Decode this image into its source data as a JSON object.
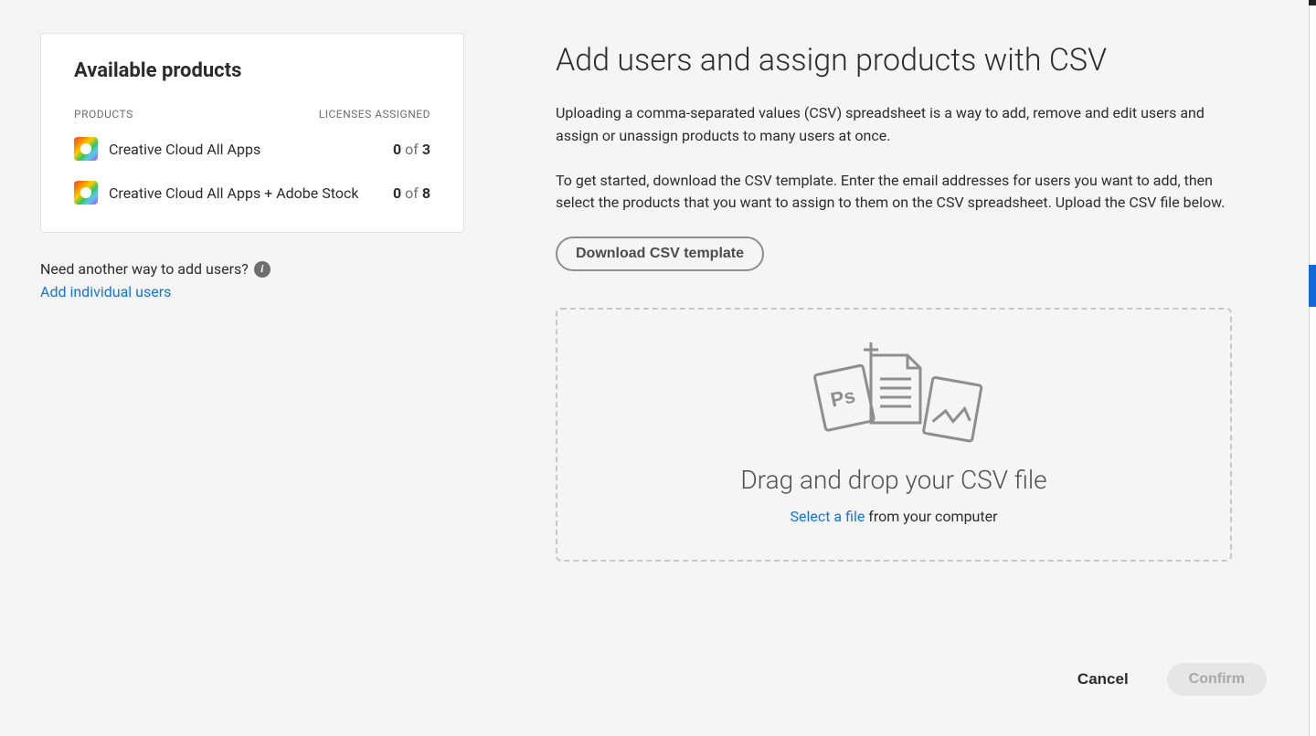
{
  "left": {
    "panel_title": "Available products",
    "col_products": "PRODUCTS",
    "col_licenses": "LICENSES ASSIGNED",
    "products": [
      {
        "name": "Creative Cloud All Apps",
        "used": "0",
        "of": "of",
        "total": "3"
      },
      {
        "name": "Creative Cloud All Apps + Adobe Stock",
        "used": "0",
        "of": "of",
        "total": "8"
      }
    ],
    "need_another": "Need another way to add users?",
    "add_individual": "Add individual users"
  },
  "main": {
    "title": "Add users and assign products with CSV",
    "para1": "Uploading a comma-separated values (CSV) spreadsheet is a way to add, remove and edit users and assign or unassign products to many users at once.",
    "para2": "To get started, download the CSV template. Enter the email addresses for users you want to add, then select the products that you want to assign to them on the CSV spreadsheet. Upload the CSV file below.",
    "download_btn": "Download CSV template",
    "drop_title": "Drag and drop your CSV file",
    "select_file": "Select a file",
    "from_computer": " from your computer"
  },
  "footer": {
    "cancel": "Cancel",
    "confirm": "Confirm"
  }
}
